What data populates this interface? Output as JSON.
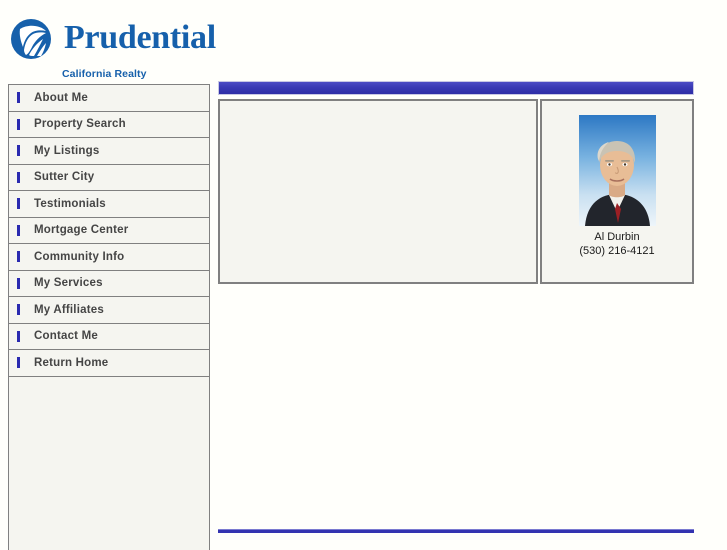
{
  "header": {
    "brand_name": "Prudential",
    "subtitle": "California Realty",
    "logo_icon": "prudential-rock-logo",
    "brand_color": "#1660ab"
  },
  "sidebar": {
    "items": [
      {
        "label": "About Me",
        "bullet_icon": "bar-bullet-icon"
      },
      {
        "label": "Property Search",
        "bullet_icon": "bar-bullet-icon"
      },
      {
        "label": "My Listings",
        "bullet_icon": "bar-bullet-icon"
      },
      {
        "label": "Sutter City",
        "bullet_icon": "bar-bullet-icon"
      },
      {
        "label": "Testimonials",
        "bullet_icon": "bar-bullet-icon"
      },
      {
        "label": "Mortgage Center",
        "bullet_icon": "bar-bullet-icon"
      },
      {
        "label": "Community Info",
        "bullet_icon": "bar-bullet-icon"
      },
      {
        "label": "My Services",
        "bullet_icon": "bar-bullet-icon"
      },
      {
        "label": "My Affiliates",
        "bullet_icon": "bar-bullet-icon"
      },
      {
        "label": "Contact Me",
        "bullet_icon": "bar-bullet-icon"
      },
      {
        "label": "Return Home",
        "bullet_icon": "bar-bullet-icon"
      }
    ],
    "bullet_color": "#2a2ab0",
    "item_background": "#f5f5f0"
  },
  "main": {
    "banner_color": "#3a3ab4",
    "content_panel": {
      "text": ""
    },
    "footer_rule_color": "#3333b0"
  },
  "agent": {
    "name": "Al Durbin",
    "phone": "(530) 216-4121",
    "photo_icon": "agent-portrait-photo"
  }
}
